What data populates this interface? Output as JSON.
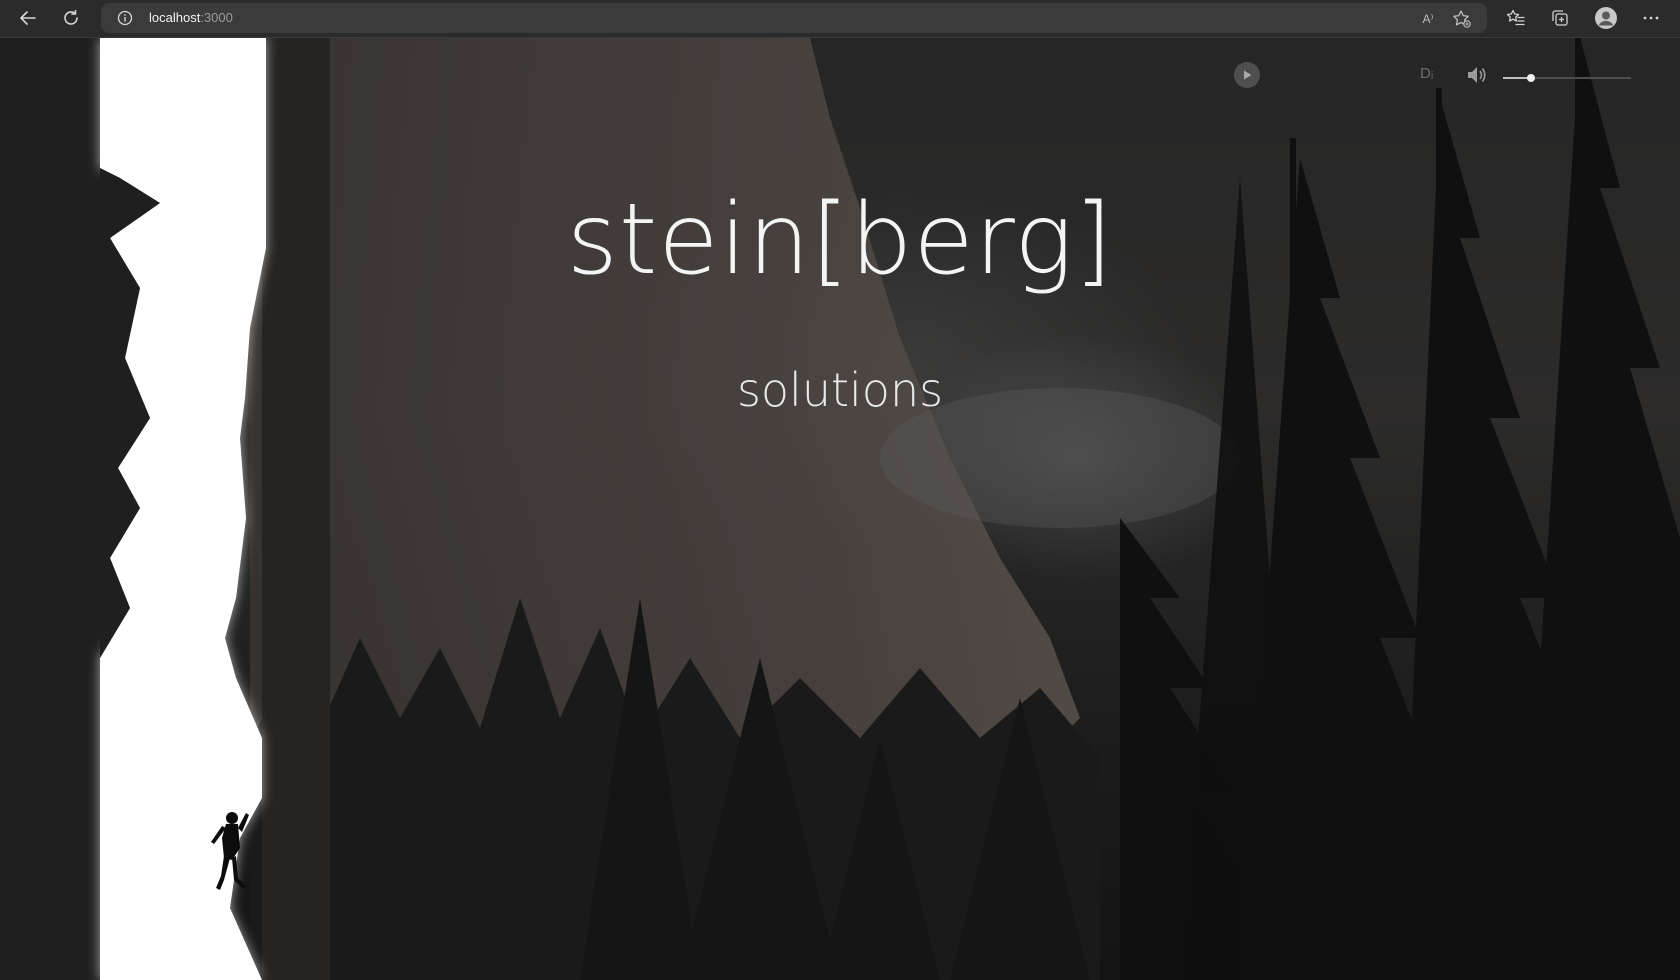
{
  "browser": {
    "url_host": "localhost",
    "url_port": ":3000",
    "read_aloud_label": "A⁾"
  },
  "hero": {
    "title": "stein[berg]",
    "subtitle": "solutions"
  },
  "media_player": {
    "speed_label": "Dᵢ",
    "volume_level": 0.22
  },
  "colors": {
    "chrome_bg": "#2b2b2b",
    "address_bar_bg": "#3b3b3b",
    "page_bg": "#1e1e1e",
    "text": "#f4f4f4"
  }
}
